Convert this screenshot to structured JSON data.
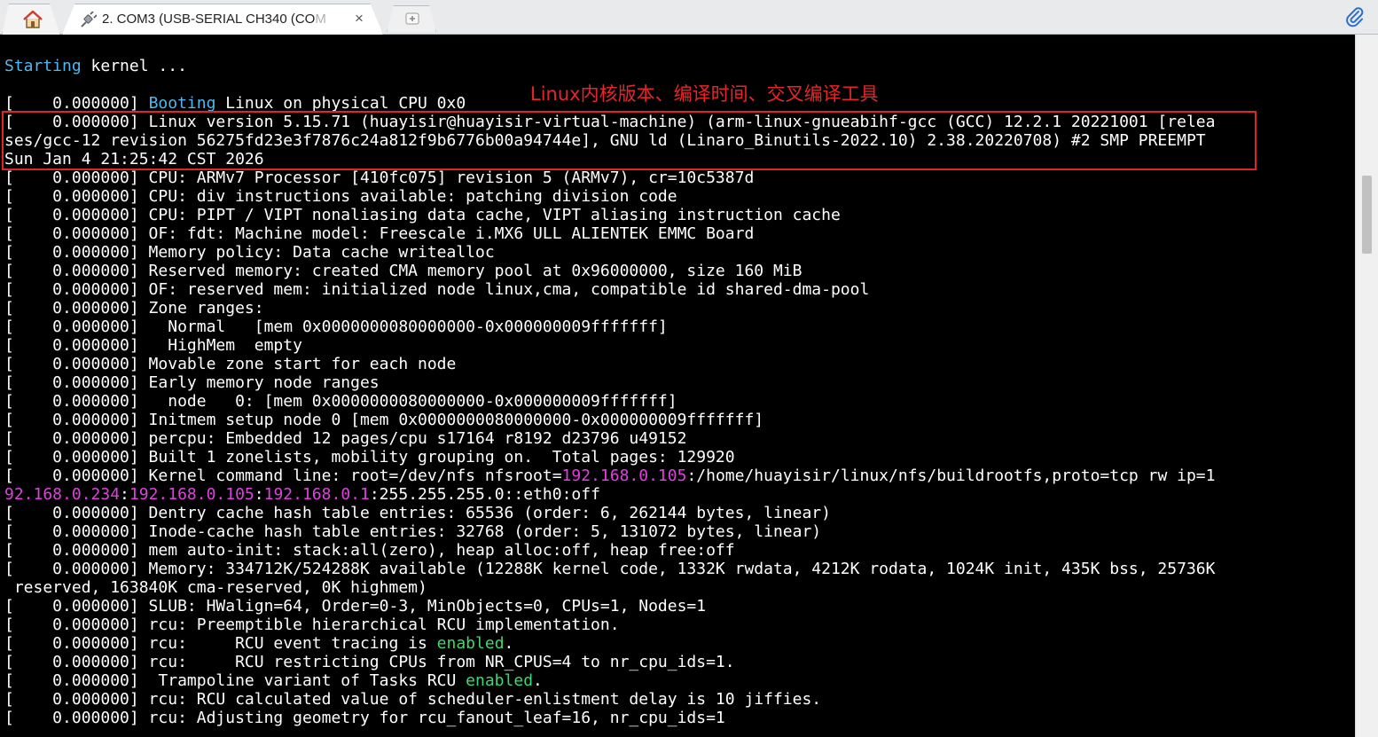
{
  "tabs": {
    "session_title": "2. COM3  (USB-SERIAL CH340 (CO",
    "session_title_fade": "M",
    "close_glyph": "×",
    "icons": {
      "home": "home-icon",
      "plug": "serial-plug-icon",
      "new_tab": "new-tab-icon",
      "attach": "paperclip-icon"
    }
  },
  "annotation": {
    "label": "Linux内核版本、编译时间、交叉编译工具",
    "color": "#e0242b"
  },
  "colors": {
    "cyan": "#4fb8f0",
    "magenta": "#e040e0",
    "green": "#3fd870",
    "background": "#000000",
    "text": "#ffffff"
  },
  "terminal": {
    "lines": [
      [
        {
          "t": "Starting",
          "c": "c-cyan"
        },
        {
          "t": " kernel ..."
        }
      ],
      [
        {
          "t": ""
        }
      ],
      [
        {
          "t": "[    0.000000] "
        },
        {
          "t": "Booting",
          "c": "c-cyan"
        },
        {
          "t": " Linux on physical CPU 0x0"
        }
      ],
      [
        {
          "t": "[    0.000000] Linux version 5.15.71 (huayisir@huayisir-virtual-machine) (arm-linux-gnueabihf-gcc (GCC) 12.2.1 20221001 [relea"
        }
      ],
      [
        {
          "t": "ses/gcc-12 revision 56275fd23e3f7876c24a812f9b6776b00a94744e], GNU ld (Linaro_Binutils-2022.10) 2.38.20220708) #2 SMP PREEMPT"
        }
      ],
      [
        {
          "t": "Sun Jan 4 21:25:42 CST 2026"
        }
      ],
      [
        {
          "t": "[    0.000000] CPU: ARMv7 Processor [410fc075] revision 5 (ARMv7), cr=10c5387d"
        }
      ],
      [
        {
          "t": "[    0.000000] CPU: div instructions available: patching division code"
        }
      ],
      [
        {
          "t": "[    0.000000] CPU: PIPT / VIPT nonaliasing data cache, VIPT aliasing instruction cache"
        }
      ],
      [
        {
          "t": "[    0.000000] OF: fdt: Machine model: Freescale i.MX6 ULL ALIENTEK EMMC Board"
        }
      ],
      [
        {
          "t": "[    0.000000] Memory policy: Data cache writealloc"
        }
      ],
      [
        {
          "t": "[    0.000000] Reserved memory: created CMA memory pool at 0x96000000, size 160 MiB"
        }
      ],
      [
        {
          "t": "[    0.000000] OF: reserved mem: initialized node linux,cma, compatible id shared-dma-pool"
        }
      ],
      [
        {
          "t": "[    0.000000] Zone ranges:"
        }
      ],
      [
        {
          "t": "[    0.000000]   Normal   [mem 0x0000000080000000-0x000000009fffffff]"
        }
      ],
      [
        {
          "t": "[    0.000000]   HighMem  empty"
        }
      ],
      [
        {
          "t": "[    0.000000] Movable zone start for each node"
        }
      ],
      [
        {
          "t": "[    0.000000] Early memory node ranges"
        }
      ],
      [
        {
          "t": "[    0.000000]   node   0: [mem 0x0000000080000000-0x000000009fffffff]"
        }
      ],
      [
        {
          "t": "[    0.000000] Initmem setup node 0 [mem 0x0000000080000000-0x000000009fffffff]"
        }
      ],
      [
        {
          "t": "[    0.000000] percpu: Embedded 12 pages/cpu s17164 r8192 d23796 u49152"
        }
      ],
      [
        {
          "t": "[    0.000000] Built 1 zonelists, mobility grouping on.  Total pages: 129920"
        }
      ],
      [
        {
          "t": "[    0.000000] Kernel command line: root=/dev/nfs nfsroot="
        },
        {
          "t": "192.168.0.105",
          "c": "c-mag"
        },
        {
          "t": ":/home/huayisir/linux/nfs/buildrootfs,proto=tcp rw ip=1"
        }
      ],
      [
        {
          "t": "92.168.0.234",
          "c": "c-mag"
        },
        {
          "t": ":"
        },
        {
          "t": "192.168.0.105",
          "c": "c-mag"
        },
        {
          "t": ":"
        },
        {
          "t": "192.168.0.1",
          "c": "c-mag"
        },
        {
          "t": ":255.255.255.0::eth0:off"
        }
      ],
      [
        {
          "t": "[    0.000000] Dentry cache hash table entries: 65536 (order: 6, 262144 bytes, linear)"
        }
      ],
      [
        {
          "t": "[    0.000000] Inode-cache hash table entries: 32768 (order: 5, 131072 bytes, linear)"
        }
      ],
      [
        {
          "t": "[    0.000000] mem auto-init: stack:all(zero), heap alloc:off, heap free:off"
        }
      ],
      [
        {
          "t": "[    0.000000] Memory: 334712K/524288K available (12288K kernel code, 1332K rwdata, 4212K rodata, 1024K init, 435K bss, 25736K"
        }
      ],
      [
        {
          "t": " reserved, 163840K cma-reserved, 0K highmem)"
        }
      ],
      [
        {
          "t": "[    0.000000] SLUB: HWalign=64, Order=0-3, MinObjects=0, CPUs=1, Nodes=1"
        }
      ],
      [
        {
          "t": "[    0.000000] rcu: Preemptible hierarchical RCU implementation."
        }
      ],
      [
        {
          "t": "[    0.000000] rcu:     RCU event tracing is "
        },
        {
          "t": "enabled",
          "c": "c-grn"
        },
        {
          "t": "."
        }
      ],
      [
        {
          "t": "[    0.000000] rcu:     RCU restricting CPUs from NR_CPUS=4 to nr_cpu_ids=1."
        }
      ],
      [
        {
          "t": "[    0.000000]  Trampoline variant of Tasks RCU "
        },
        {
          "t": "enabled",
          "c": "c-grn"
        },
        {
          "t": "."
        }
      ],
      [
        {
          "t": "[    0.000000] rcu: RCU calculated value of scheduler-enlistment delay is 10 jiffies."
        }
      ],
      [
        {
          "t": "[    0.000000] rcu: Adjusting geometry for rcu_fanout_leaf=16, nr_cpu_ids=1"
        }
      ]
    ]
  }
}
